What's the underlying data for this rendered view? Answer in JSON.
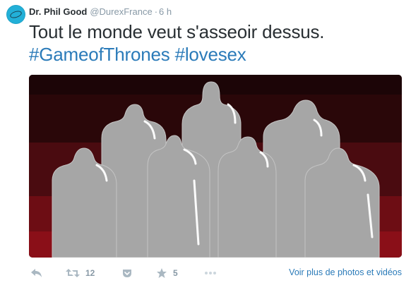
{
  "tweet": {
    "author_name": "Dr. Phil Good",
    "handle": "@DurexFrance",
    "separator": "·",
    "time": "6 h",
    "text": "Tout le monde veut s'asseoir dessus.",
    "hashtags": [
      "#GameofThrones",
      "#lovesex"
    ]
  },
  "media": {
    "description_icons": "condom-throne-illustration",
    "background_bands": [
      "#1c0507",
      "#2a0709",
      "#4a0b10",
      "#6d0d14",
      "#8a0f18"
    ],
    "shape_color": "#a6a6a6",
    "highlight_color": "#ffffff"
  },
  "actions": {
    "reply_icon": "reply-icon",
    "retweet_icon": "retweet-icon",
    "retweet_count": "12",
    "save_icon": "pocket-icon",
    "favorite_icon": "star-icon",
    "favorite_count": "5",
    "more_icon": "more-dots-icon",
    "view_media_label": "Voir plus de photos et vidéos"
  }
}
